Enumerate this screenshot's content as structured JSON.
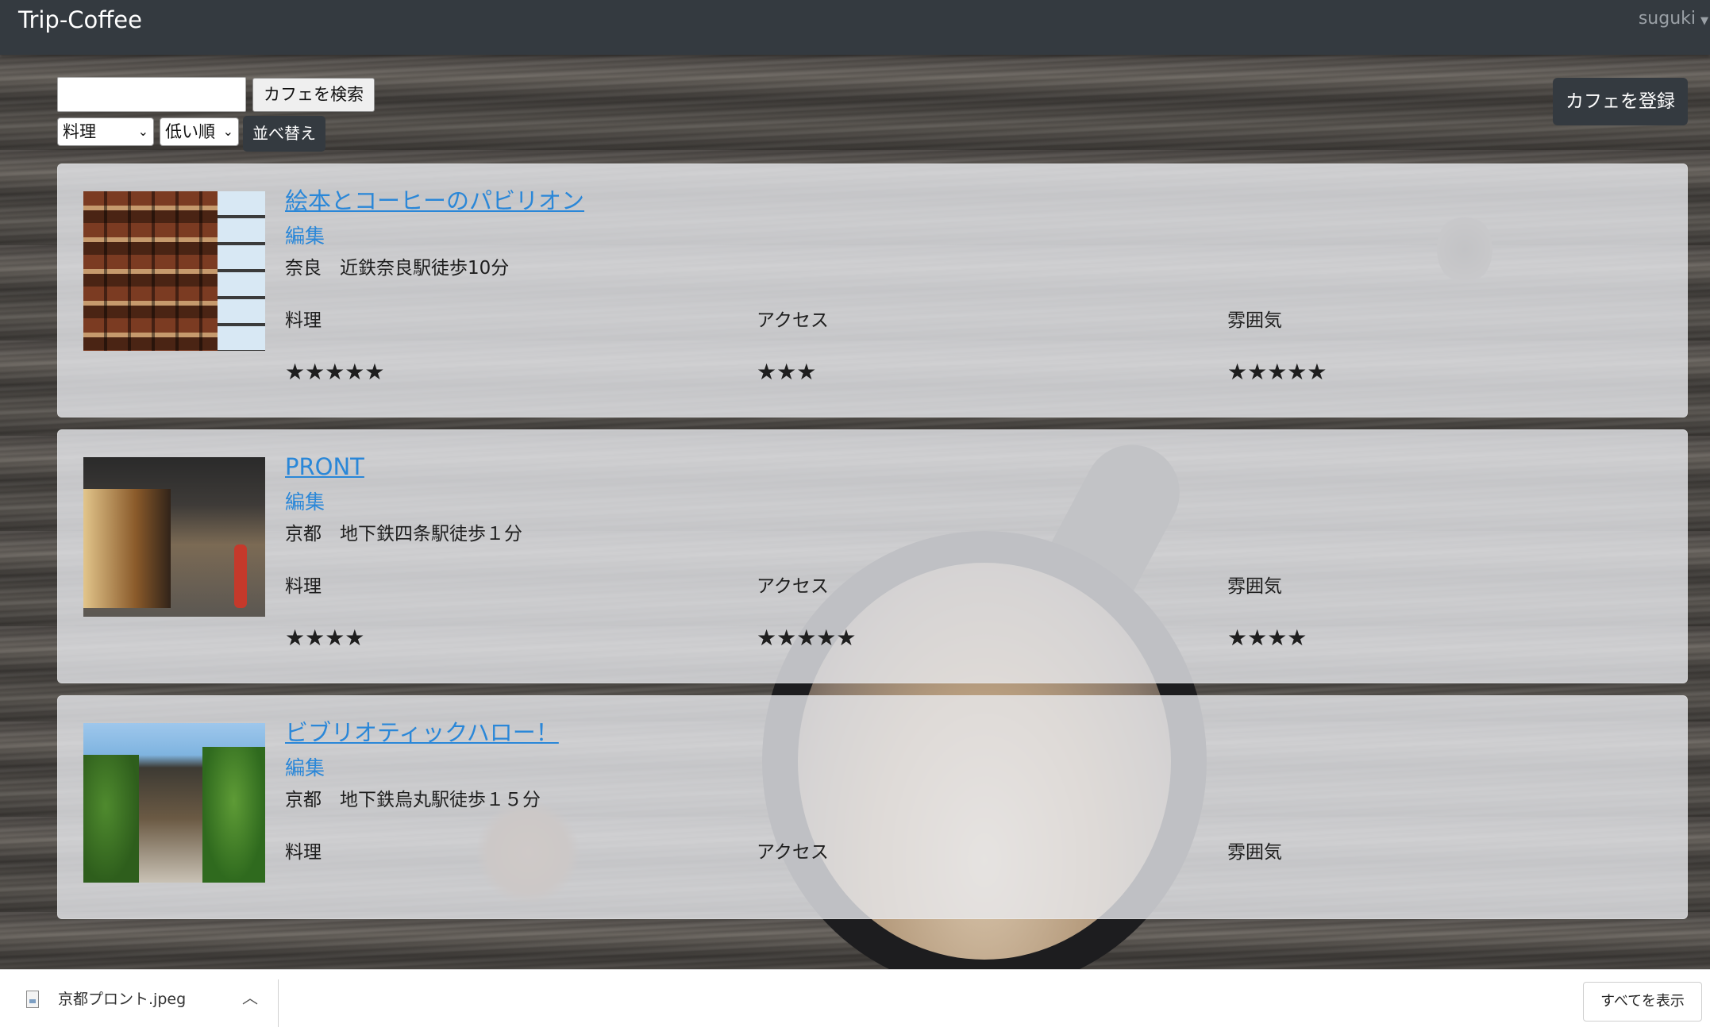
{
  "navbar": {
    "brand": "Trip-Coffee",
    "user": "suguki"
  },
  "controls": {
    "search_value": "",
    "search_button": "カフェを検索",
    "category_selected": "料理",
    "order_selected": "低い順",
    "sort_button": "並べ替え",
    "register_button": "カフェを登録"
  },
  "rating_labels": {
    "food": "料理",
    "access": "アクセス",
    "atmosphere": "雰囲気"
  },
  "cafes": [
    {
      "name": "絵本とコーヒーのパビリオン",
      "edit": "編集",
      "location": "奈良　近鉄奈良駅徒歩10分",
      "stars_food": "★★★★★",
      "stars_access": "★★★",
      "stars_atmosphere": "★★★★★",
      "rating_food": 5,
      "rating_access": 3,
      "rating_atmosphere": 5
    },
    {
      "name": "PRONT",
      "edit": "編集",
      "location": "京都　地下鉄四条駅徒歩１分",
      "stars_food": "★★★★",
      "stars_access": "★★★★★",
      "stars_atmosphere": "★★★★",
      "rating_food": 4,
      "rating_access": 5,
      "rating_atmosphere": 4
    },
    {
      "name": "ビブリオティックハロー！",
      "edit": "編集",
      "location": "京都　地下鉄烏丸駅徒歩１５分",
      "stars_food": "",
      "stars_access": "",
      "stars_atmosphere": ""
    }
  ],
  "download_bar": {
    "file_name": "京都プロント.jpeg",
    "show_all": "すべてを表示"
  },
  "icons": {
    "user_caret": "caret-down-icon",
    "select_chevron": "chevron-down-icon",
    "download_expand": "chevron-up-icon",
    "file": "image-file-icon"
  },
  "colors": {
    "navbar": "#343a40",
    "link": "#2a87d8",
    "button_dark": "#343a40"
  }
}
